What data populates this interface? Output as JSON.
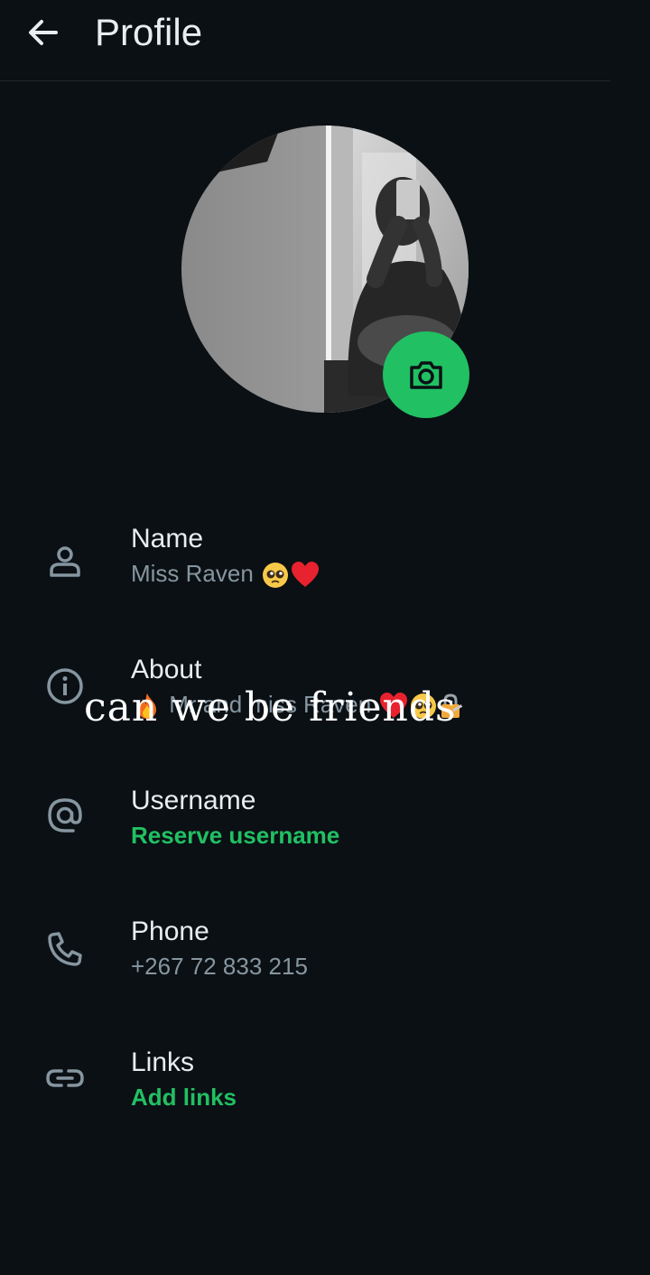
{
  "header": {
    "title": "Profile",
    "back_icon": "arrow-left-icon"
  },
  "avatar": {
    "camera_icon": "camera-icon",
    "accent_color": "#21c063"
  },
  "fields": {
    "name": {
      "label": "Name",
      "value": "Miss Raven",
      "icon": "person-icon"
    },
    "about": {
      "label": "About",
      "value": "Mr and miss Raven",
      "icon": "info-icon"
    },
    "username": {
      "label": "Username",
      "value": "Reserve username",
      "icon": "at-icon"
    },
    "phone": {
      "label": "Phone",
      "value": "+267 72 833 215",
      "icon": "phone-icon"
    },
    "links": {
      "label": "Links",
      "value": "Add links",
      "icon": "link-icon"
    }
  },
  "overlay": {
    "caption": "can we be friends"
  },
  "colors": {
    "background": "#0b1014",
    "primary_text": "#e9edef",
    "secondary_text": "#8696a0",
    "accent": "#21c063"
  }
}
